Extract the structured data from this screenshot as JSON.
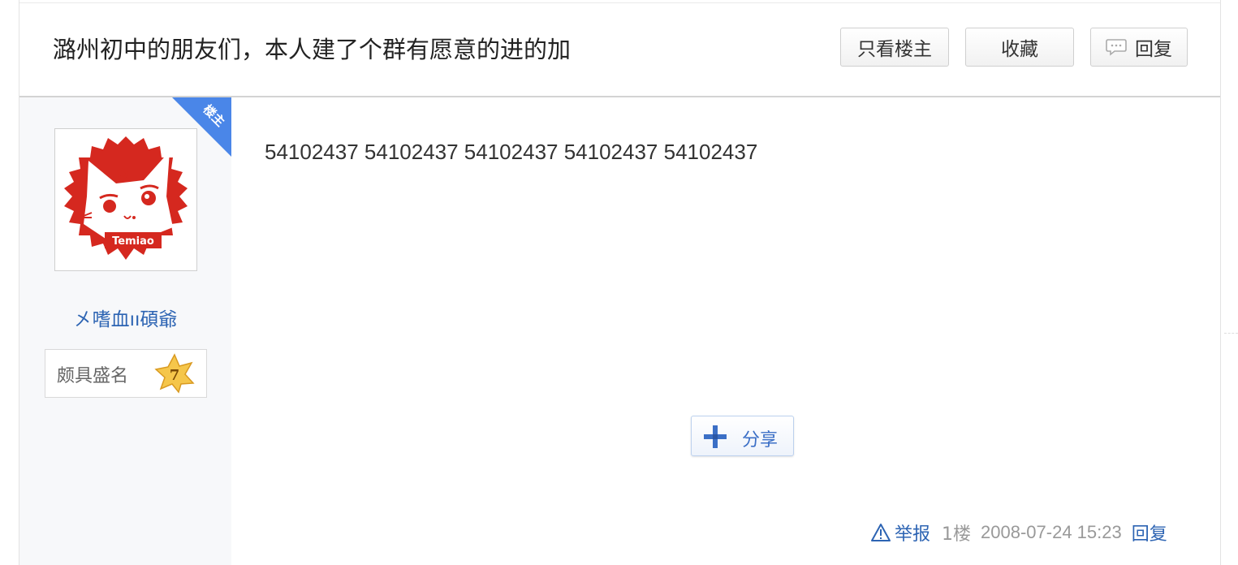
{
  "thread": {
    "title": "潞州初中的朋友们，本人建了个群有愿意的进的加"
  },
  "toolbar": {
    "only_op_label": "只看楼主",
    "favorite_label": "收藏",
    "reply_label": "回复"
  },
  "post": {
    "op_badge": "楼主",
    "author": {
      "name": "㐅嗜血ıı碩爺",
      "avatar_text": "Temiao",
      "rank_title": "颇具盛名",
      "level": "7"
    },
    "content": "54102437 54102437 54102437 54102437 54102437",
    "share_label": "分享",
    "footer": {
      "report_label": "举报",
      "floor": "1楼",
      "time": "2008-07-24 15:23",
      "reply_label": "回复"
    }
  },
  "colors": {
    "link": "#2d64b3",
    "badge": "#4a86e8",
    "avatar_red": "#d5281f",
    "sidebar_bg": "#f7f8fa"
  }
}
